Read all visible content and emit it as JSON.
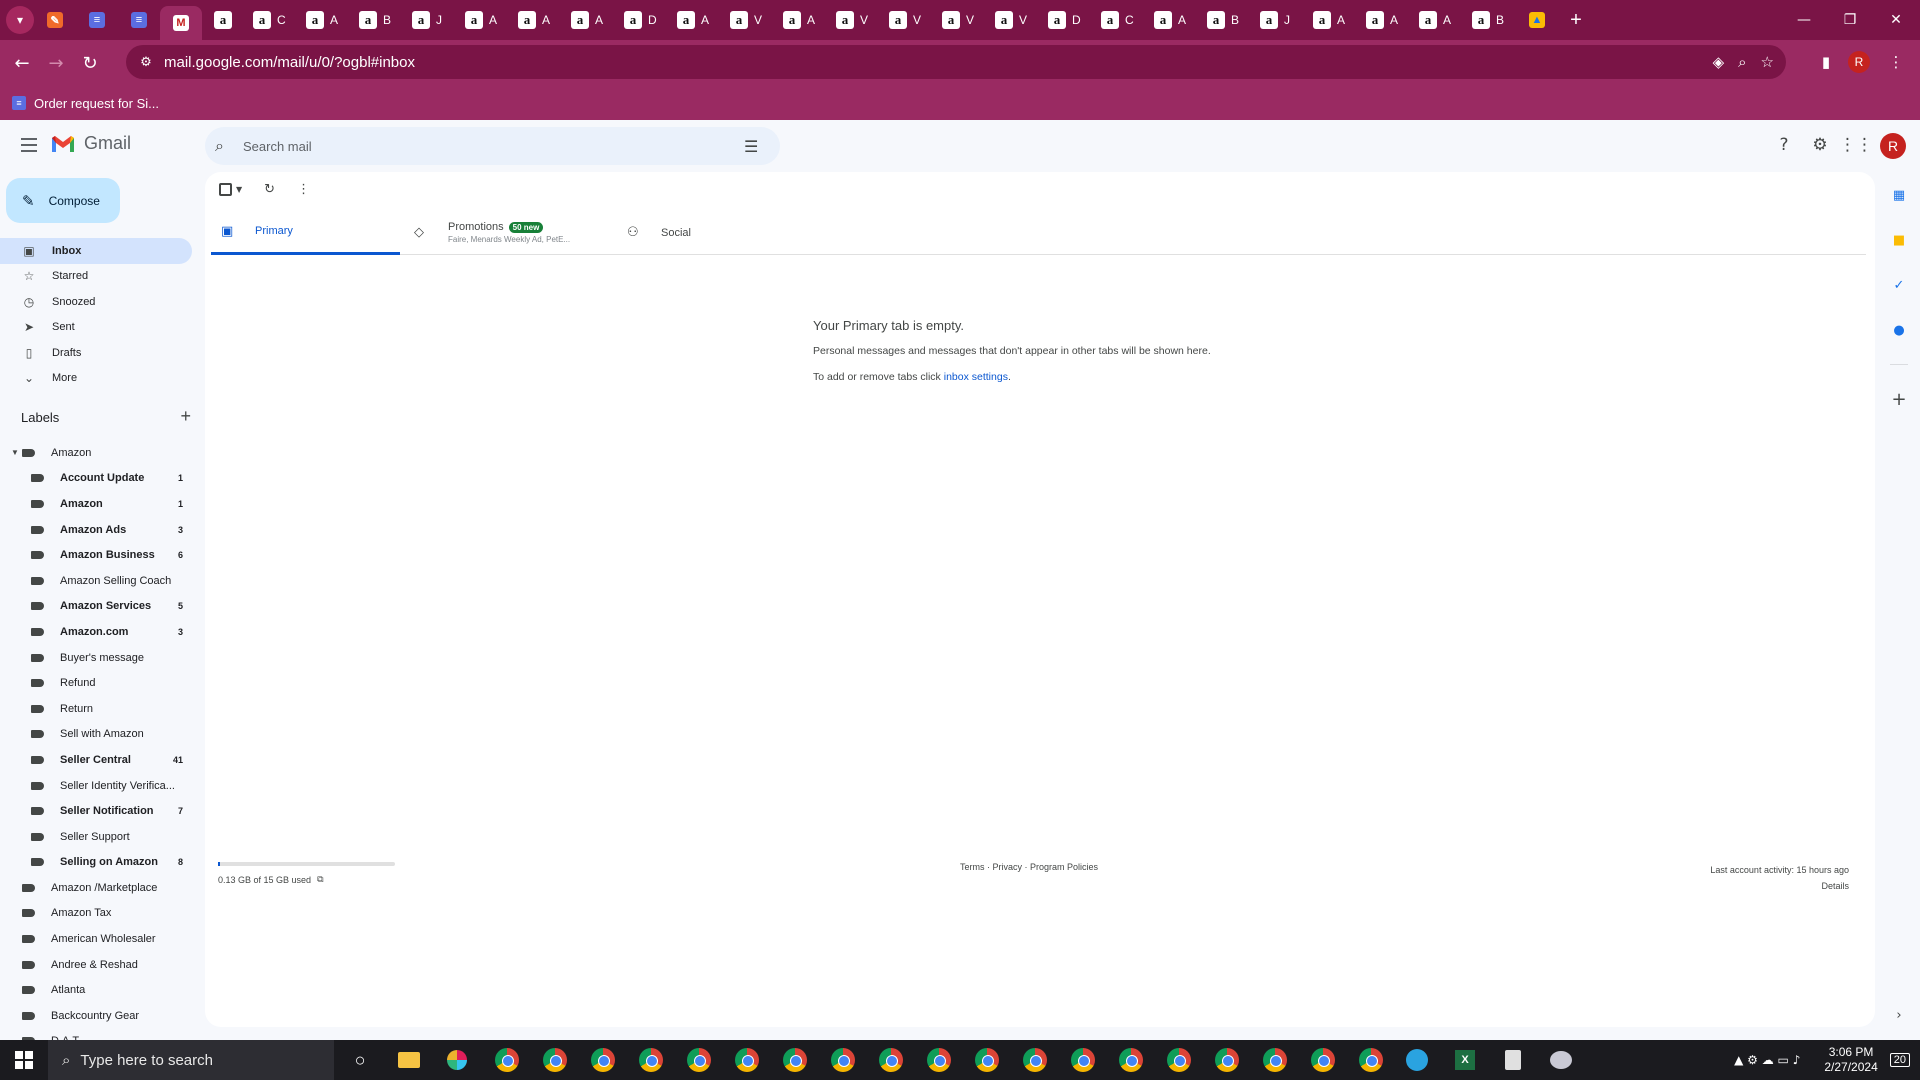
{
  "browser": {
    "url": "mail.google.com/mail/u/0/?ogbl#inbox",
    "bookmark": "Order request for Si...",
    "profile_initial": "R",
    "tab_letters": [
      "C",
      "A",
      "B",
      "J",
      "A",
      "A",
      "A",
      "D",
      "A",
      "V",
      "A",
      "V",
      "V",
      "V",
      "V",
      "D",
      "C",
      "A",
      "B",
      "J",
      "A",
      "A",
      "A",
      "B"
    ]
  },
  "gmail": {
    "logo_text": "Gmail",
    "search_placeholder": "Search mail",
    "account_initial": "R",
    "compose_label": "Compose",
    "nav": [
      {
        "label": "Inbox",
        "icon": "inbox-icon"
      },
      {
        "label": "Starred",
        "icon": "star-icon"
      },
      {
        "label": "Snoozed",
        "icon": "clock-icon"
      },
      {
        "label": "Sent",
        "icon": "send-icon"
      },
      {
        "label": "Drafts",
        "icon": "draft-icon"
      },
      {
        "label": "More",
        "icon": "chevron-down-icon"
      }
    ],
    "labels_title": "Labels",
    "labels": [
      {
        "name": "Amazon",
        "count": "",
        "indent": 0,
        "bold": false
      },
      {
        "name": "Account Update",
        "count": "1",
        "indent": 1,
        "bold": true
      },
      {
        "name": "Amazon",
        "count": "1",
        "indent": 1,
        "bold": true
      },
      {
        "name": "Amazon Ads",
        "count": "3",
        "indent": 1,
        "bold": true
      },
      {
        "name": "Amazon Business",
        "count": "6",
        "indent": 1,
        "bold": true
      },
      {
        "name": "Amazon Selling Coach",
        "count": "",
        "indent": 1,
        "bold": false
      },
      {
        "name": "Amazon Services",
        "count": "5",
        "indent": 1,
        "bold": true
      },
      {
        "name": "Amazon.com",
        "count": "3",
        "indent": 1,
        "bold": true
      },
      {
        "name": "Buyer's message",
        "count": "",
        "indent": 1,
        "bold": false
      },
      {
        "name": "Refund",
        "count": "",
        "indent": 1,
        "bold": false
      },
      {
        "name": "Return",
        "count": "",
        "indent": 1,
        "bold": false
      },
      {
        "name": "Sell with Amazon",
        "count": "",
        "indent": 1,
        "bold": false
      },
      {
        "name": "Seller Central",
        "count": "41",
        "indent": 1,
        "bold": true
      },
      {
        "name": "Seller Identity Verifica...",
        "count": "",
        "indent": 1,
        "bold": false
      },
      {
        "name": "Seller Notification",
        "count": "7",
        "indent": 1,
        "bold": true
      },
      {
        "name": "Seller Support",
        "count": "",
        "indent": 1,
        "bold": false
      },
      {
        "name": "Selling on Amazon",
        "count": "8",
        "indent": 1,
        "bold": true
      },
      {
        "name": "Amazon /Marketplace",
        "count": "",
        "indent": 0,
        "bold": false
      },
      {
        "name": "Amazon Tax",
        "count": "",
        "indent": 0,
        "bold": false
      },
      {
        "name": "American Wholesaler",
        "count": "",
        "indent": 0,
        "bold": false
      },
      {
        "name": "Andree & Reshad",
        "count": "",
        "indent": 0,
        "bold": false
      },
      {
        "name": "Atlanta",
        "count": "",
        "indent": 0,
        "bold": false
      },
      {
        "name": "Backcountry Gear",
        "count": "",
        "indent": 0,
        "bold": false
      },
      {
        "name": "D.A.T",
        "count": "",
        "indent": 0,
        "bold": false
      }
    ],
    "tabs": {
      "primary": "Primary",
      "promotions": "Promotions",
      "promotions_badge": "50 new",
      "promotions_sub": "Faire, Menards Weekly Ad, PetE...",
      "social": "Social"
    },
    "empty": {
      "title": "Your Primary tab is empty.",
      "line1": "Personal messages and messages that don't appear in other tabs will be shown here.",
      "line2_prefix": "To add or remove tabs click ",
      "line2_link": "inbox settings",
      "line2_suffix": "."
    },
    "footer": {
      "storage": "0.13 GB of 15 GB used",
      "storage_fraction": 0.0087,
      "links": "Terms · Privacy · Program Policies",
      "activity": "Last account activity: 15 hours ago",
      "details": "Details"
    }
  },
  "taskbar": {
    "search_placeholder": "Type here to search",
    "time": "3:06 PM",
    "date": "2/27/2024",
    "notif_count": "20"
  },
  "colors": {
    "browser_frame": "#7a1446",
    "browser_toolbar": "#9a2a62",
    "compose_bg": "#c2e7ff",
    "active_nav": "#d3e3fd",
    "accent_blue": "#0b57d0",
    "promo_badge": "#188038"
  }
}
